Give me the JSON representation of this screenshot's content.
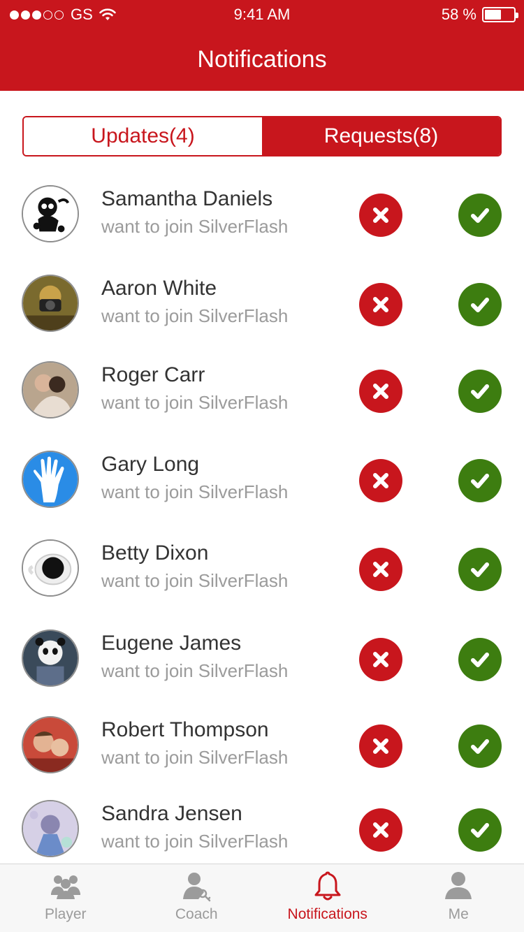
{
  "status_bar": {
    "carrier": "GS",
    "time": "9:41 AM",
    "battery": "58 %",
    "battery_level": 0.58,
    "signal_bars": 3
  },
  "header": {
    "title": "Notifications"
  },
  "segments": {
    "updates": "Updates(4)",
    "requests": "Requests(8)",
    "active": "requests"
  },
  "requests": [
    {
      "name": "Samantha Daniels",
      "message": "want to join SilverFlash"
    },
    {
      "name": "Aaron White",
      "message": "want to join SilverFlash"
    },
    {
      "name": "Roger Carr",
      "message": "want to join SilverFlash"
    },
    {
      "name": "Gary Long",
      "message": "want to join SilverFlash"
    },
    {
      "name": "Betty Dixon",
      "message": "want to join SilverFlash"
    },
    {
      "name": "Eugene James",
      "message": "want to join SilverFlash"
    },
    {
      "name": "Robert Thompson",
      "message": "want to join SilverFlash"
    },
    {
      "name": "Sandra Jensen",
      "message": "want to join SilverFlash"
    }
  ],
  "tabbar": {
    "player": "Player",
    "coach": "Coach",
    "notifications": "Notifications",
    "me": "Me",
    "active": "notifications"
  },
  "colors": {
    "brand_red": "#c8161d",
    "accept_green": "#3d7d10",
    "muted_text": "#9b9b9b"
  },
  "icons": {
    "reject": "x-icon",
    "accept": "check-icon",
    "tab_player": "group-icon",
    "tab_coach": "coach-icon",
    "tab_notifications": "bell-icon",
    "tab_me": "person-icon"
  }
}
